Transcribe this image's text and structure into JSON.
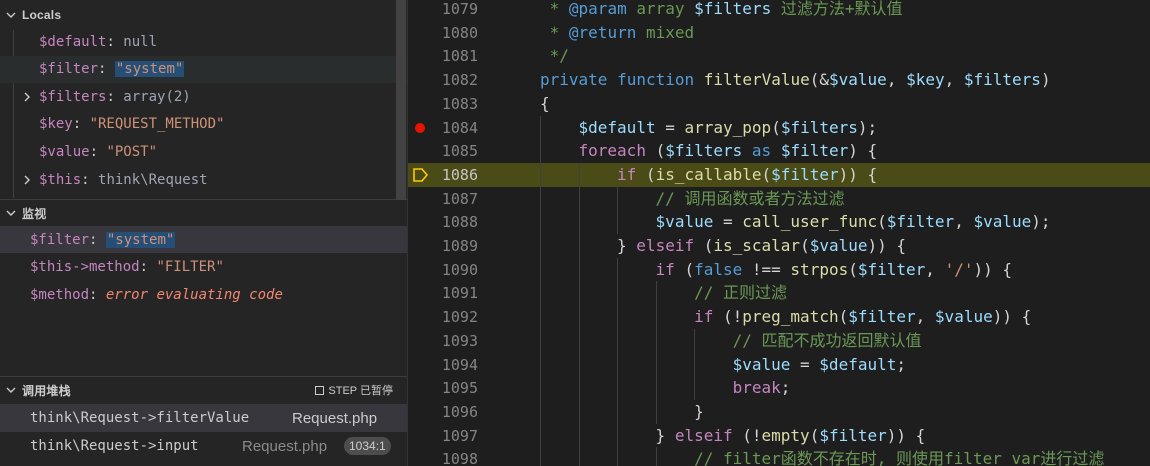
{
  "locals": {
    "title": "Locals",
    "vars": [
      {
        "name": "$default",
        "value": "null",
        "kind": "plain",
        "expandable": false
      },
      {
        "name": "$filter",
        "value": "\"system\"",
        "kind": "str",
        "expandable": false
      },
      {
        "name": "$filters",
        "value": "array(2)",
        "kind": "plain",
        "expandable": true
      },
      {
        "name": "$key",
        "value": "\"REQUEST_METHOD\"",
        "kind": "str",
        "expandable": false
      },
      {
        "name": "$value",
        "value": "\"POST\"",
        "kind": "str",
        "expandable": false
      },
      {
        "name": "$this",
        "value": "think\\Request",
        "kind": "plain",
        "expandable": true
      }
    ]
  },
  "watch": {
    "title": "监视",
    "items": [
      {
        "expr": "$filter",
        "value": "\"system\"",
        "kind": "str"
      },
      {
        "expr": "$this->method",
        "value": "\"FILTER\"",
        "kind": "str"
      },
      {
        "expr": "$method",
        "value": "error evaluating code",
        "kind": "err"
      }
    ]
  },
  "callstack": {
    "title": "调用堆栈",
    "status": "STEP 已暂停",
    "frames": [
      {
        "fn": "think\\Request->filterValue",
        "file": "Request.php",
        "line": ""
      },
      {
        "fn": "think\\Request->input",
        "file": "Request.php",
        "line": "1034:1"
      }
    ]
  },
  "editor": {
    "current_line": "1086",
    "breakpoint_line": "1084",
    "lines": [
      {
        "n": "1079",
        "indent": 0,
        "tokens": [
          [
            " * ",
            "cmt"
          ],
          [
            "@param",
            "kw"
          ],
          [
            " array ",
            "cmt"
          ],
          [
            "$filters",
            "var"
          ],
          [
            " 过滤方法+默认值",
            "cmt"
          ]
        ]
      },
      {
        "n": "1080",
        "indent": 0,
        "tokens": [
          [
            " * ",
            "cmt"
          ],
          [
            "@return",
            "kw"
          ],
          [
            " mixed",
            "cmt"
          ]
        ]
      },
      {
        "n": "1081",
        "indent": 0,
        "tokens": [
          [
            " */",
            "cmt"
          ]
        ]
      },
      {
        "n": "1082",
        "indent": 0,
        "tokens": [
          [
            "private",
            "kw"
          ],
          [
            " ",
            "pl"
          ],
          [
            "function",
            "kw"
          ],
          [
            " ",
            "pl"
          ],
          [
            "filterValue",
            "fn"
          ],
          [
            "(&",
            "pl"
          ],
          [
            "$value",
            "var"
          ],
          [
            ", ",
            "pl"
          ],
          [
            "$key",
            "var"
          ],
          [
            ", ",
            "pl"
          ],
          [
            "$filters",
            "var"
          ],
          [
            ")",
            "pl"
          ]
        ]
      },
      {
        "n": "1083",
        "indent": 0,
        "tokens": [
          [
            "{",
            "pl"
          ]
        ]
      },
      {
        "n": "1084",
        "indent": 1,
        "tokens": [
          [
            "$default",
            "var"
          ],
          [
            " = ",
            "pl"
          ],
          [
            "array_pop",
            "fn"
          ],
          [
            "(",
            "pl"
          ],
          [
            "$filters",
            "var"
          ],
          [
            ");",
            "pl"
          ]
        ]
      },
      {
        "n": "1085",
        "indent": 1,
        "tokens": [
          [
            "foreach",
            "ctl"
          ],
          [
            " (",
            "pl"
          ],
          [
            "$filters",
            "var"
          ],
          [
            " as ",
            "kw"
          ],
          [
            "$filter",
            "var"
          ],
          [
            ") {",
            "pl"
          ]
        ]
      },
      {
        "n": "1086",
        "indent": 2,
        "tokens": [
          [
            "if",
            "ctl"
          ],
          [
            " (",
            "pl"
          ],
          [
            "is_callable",
            "fn"
          ],
          [
            "(",
            "pl"
          ],
          [
            "$filter",
            "var"
          ],
          [
            ")) {",
            "pl"
          ]
        ]
      },
      {
        "n": "1087",
        "indent": 3,
        "tokens": [
          [
            "// 调用函数或者方法过滤",
            "cmt"
          ]
        ]
      },
      {
        "n": "1088",
        "indent": 3,
        "tokens": [
          [
            "$value",
            "var"
          ],
          [
            " = ",
            "pl"
          ],
          [
            "call_user_func",
            "fn"
          ],
          [
            "(",
            "pl"
          ],
          [
            "$filter",
            "var"
          ],
          [
            ", ",
            "pl"
          ],
          [
            "$value",
            "var"
          ],
          [
            ");",
            "pl"
          ]
        ]
      },
      {
        "n": "1089",
        "indent": 2,
        "tokens": [
          [
            "} ",
            "pl"
          ],
          [
            "elseif",
            "ctl"
          ],
          [
            " (",
            "pl"
          ],
          [
            "is_scalar",
            "fn"
          ],
          [
            "(",
            "pl"
          ],
          [
            "$value",
            "var"
          ],
          [
            ")) {",
            "pl"
          ]
        ]
      },
      {
        "n": "1090",
        "indent": 3,
        "tokens": [
          [
            "if",
            "ctl"
          ],
          [
            " (",
            "pl"
          ],
          [
            "false",
            "kw"
          ],
          [
            " !== ",
            "pl"
          ],
          [
            "strpos",
            "fn"
          ],
          [
            "(",
            "pl"
          ],
          [
            "$filter",
            "var"
          ],
          [
            ", ",
            "pl"
          ],
          [
            "'/'",
            "str"
          ],
          [
            ")) {",
            "pl"
          ]
        ]
      },
      {
        "n": "1091",
        "indent": 4,
        "tokens": [
          [
            "// 正则过滤",
            "cmt"
          ]
        ]
      },
      {
        "n": "1092",
        "indent": 4,
        "tokens": [
          [
            "if",
            "ctl"
          ],
          [
            " (!",
            "pl"
          ],
          [
            "preg_match",
            "fn"
          ],
          [
            "(",
            "pl"
          ],
          [
            "$filter",
            "var"
          ],
          [
            ", ",
            "pl"
          ],
          [
            "$value",
            "var"
          ],
          [
            ")) {",
            "pl"
          ]
        ]
      },
      {
        "n": "1093",
        "indent": 5,
        "tokens": [
          [
            "// 匹配不成功返回默认值",
            "cmt"
          ]
        ]
      },
      {
        "n": "1094",
        "indent": 5,
        "tokens": [
          [
            "$value",
            "var"
          ],
          [
            " = ",
            "pl"
          ],
          [
            "$default",
            "var"
          ],
          [
            ";",
            "pl"
          ]
        ]
      },
      {
        "n": "1095",
        "indent": 5,
        "tokens": [
          [
            "break",
            "ctl"
          ],
          [
            ";",
            "pl"
          ]
        ]
      },
      {
        "n": "1096",
        "indent": 4,
        "tokens": [
          [
            "}",
            "pl"
          ]
        ]
      },
      {
        "n": "1097",
        "indent": 3,
        "tokens": [
          [
            "} ",
            "pl"
          ],
          [
            "elseif",
            "ctl"
          ],
          [
            " (!",
            "pl"
          ],
          [
            "empty",
            "fn"
          ],
          [
            "(",
            "pl"
          ],
          [
            "$filter",
            "var"
          ],
          [
            ")) {",
            "pl"
          ]
        ]
      },
      {
        "n": "1098",
        "indent": 4,
        "tokens": [
          [
            "// filter函数不存在时, 则使用filter_var进行过滤",
            "cmt"
          ]
        ]
      }
    ]
  },
  "colors": {
    "breakpoint": "#e51400",
    "current_line_bg": "#4b4b18",
    "debug_arrow": "#ffcc00"
  }
}
